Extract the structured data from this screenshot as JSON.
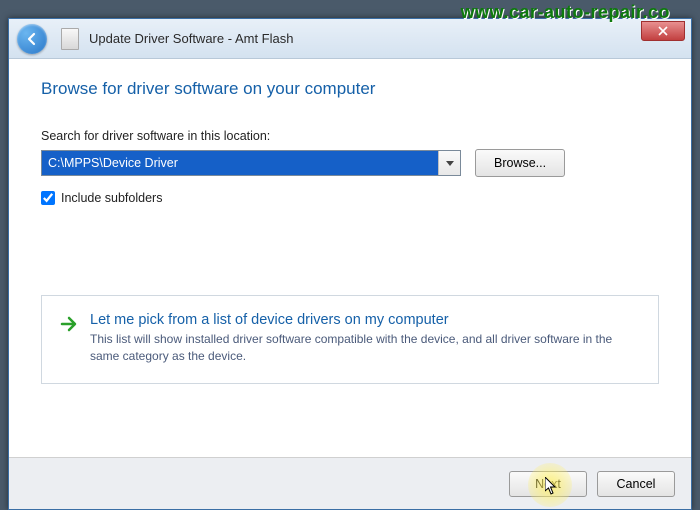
{
  "watermark": "www.car-auto-repair.co",
  "window": {
    "title": "Update Driver Software - Amt Flash"
  },
  "content": {
    "heading": "Browse for driver software on your computer",
    "search_label": "Search for driver software in this location:",
    "path_value": "C:\\MPPS\\Device Driver",
    "browse_label": "Browse...",
    "include_subfolders_label": "Include subfolders",
    "include_subfolders_checked": true,
    "option": {
      "title": "Let me pick from a list of device drivers on my computer",
      "desc": "This list will show installed driver software compatible with the device, and all driver software in the same category as the device."
    }
  },
  "footer": {
    "next_label": "Next",
    "cancel_label": "Cancel"
  }
}
